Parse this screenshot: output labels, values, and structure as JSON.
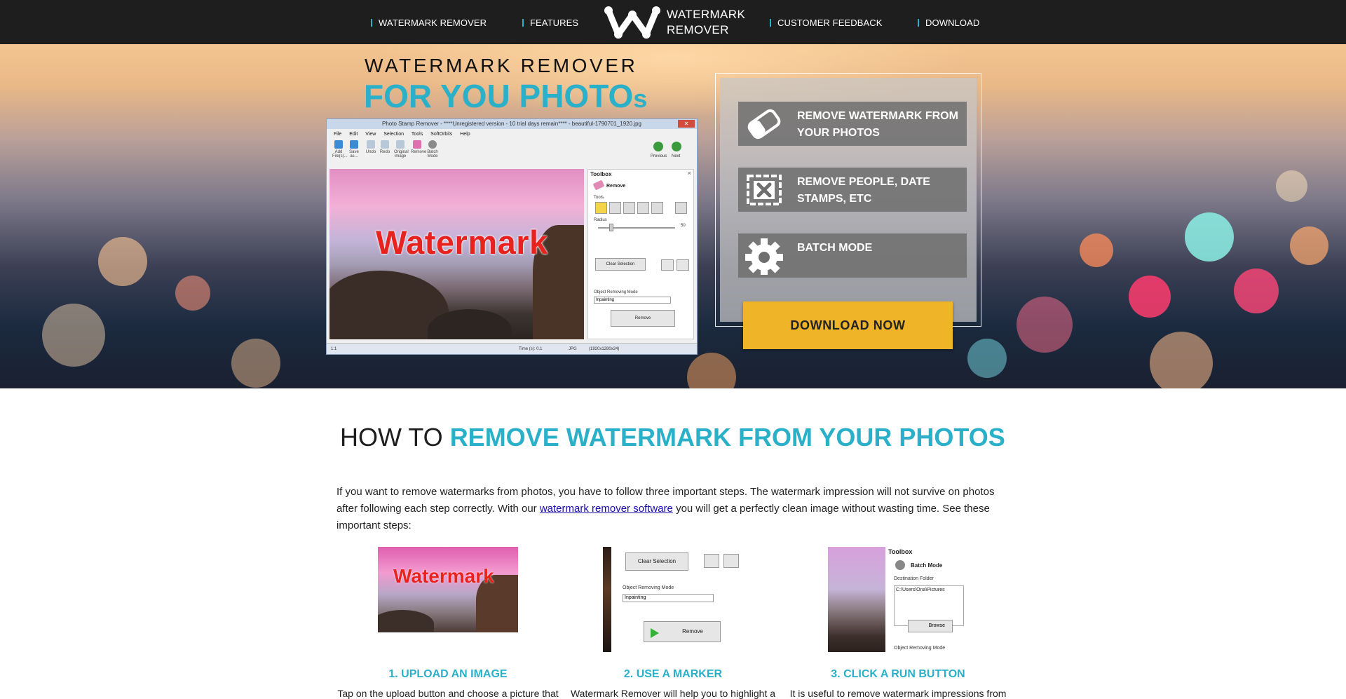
{
  "nav": {
    "items": [
      "WATERMARK REMOVER",
      "FEATURES",
      "CUSTOMER FEEDBACK",
      "DOWNLOAD"
    ],
    "logo_line1": "WATERMARK",
    "logo_line2": "REMOVER",
    "accent": "#2ab0c8",
    "background": "#1e1e1e"
  },
  "hero": {
    "title_line1": "WATERMARK  REMOVER",
    "title_line2_main": "FOR YOU PHOTO",
    "title_line2_small": "s",
    "app": {
      "window_title": "Photo Stamp Remover - ****Unregistered version - 10 trial days remain**** - beautiful-1790701_1920.jpg",
      "menu": [
        "File",
        "Edit",
        "View",
        "Selection",
        "Tools",
        "SoftOrbits",
        "Help"
      ],
      "toolbar": [
        "Add File(s)...",
        "Save as...",
        "Undo",
        "Redo",
        "Original Image",
        "Remove",
        "Batch Mode"
      ],
      "nav_prev": "Previous",
      "nav_next": "Next",
      "watermark_text": "Watermark",
      "toolbox": {
        "title": "Toolbox",
        "close": "×",
        "mode": "Remove",
        "tools_label": "Tools",
        "radius_label": "Radius",
        "radius_value": "50",
        "clear_selection": "Clear Selection",
        "object_mode_label": "Object Removing Mode",
        "object_mode_value": "Inpainting",
        "remove_button": "Remove"
      },
      "status": {
        "zoom": "1:1",
        "time": "Time (s): 0.1",
        "format": "JPG",
        "size": "(1920x1280x24)"
      }
    },
    "features": [
      {
        "icon": "eraser-icon",
        "text_line1": "REMOVE WATERMARK FROM",
        "text_line2": "YOUR PHOTOS"
      },
      {
        "icon": "close-box-icon",
        "text_line1": "REMOVE PEOPLE, DATE",
        "text_line2": "STAMPS, ETC"
      },
      {
        "icon": "gear-icon",
        "text_line1": "BATCH MODE",
        "text_line2": ""
      }
    ],
    "download_label": "DOWNLOAD NOW",
    "download_color": "#f0b429"
  },
  "howto": {
    "title_plain": "HOW TO ",
    "title_highlight": "REMOVE WATERMARK FROM YOUR PHOTOS",
    "intro_before": "If you want to remove watermarks from photos, you have to follow three important steps. The watermark impression will not survive on photos after following each step correctly. With our ",
    "intro_link": "watermark remover software",
    "intro_after": " you will get a perfectly clean image without wasting time. See these important steps:",
    "step2_thumb": {
      "clear_selection": "Clear Selection",
      "mode_label": "Object Removing Mode",
      "mode_value": "Inpainting",
      "remove": "Remove"
    },
    "step3_thumb": {
      "toolbox": "Toolbox",
      "batch_mode": "Batch Mode",
      "destination": "Destination Folder",
      "path": "C:\\Users\\Ona\\Pictures",
      "browse": "Browse",
      "mode_label": "Object Removing Mode"
    },
    "steps": [
      {
        "title": "1. UPLOAD AN IMAGE",
        "text": "Tap on the upload button and choose a picture that"
      },
      {
        "title": "2. USE A MARKER",
        "text": "Watermark Remover will help you to highlight a"
      },
      {
        "title": "3. CLICK A RUN BUTTON",
        "text": "It is useful to remove watermark impressions from"
      }
    ]
  }
}
